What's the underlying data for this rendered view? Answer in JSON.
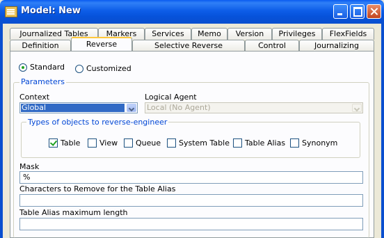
{
  "window": {
    "title": "Model: New"
  },
  "tabs_row1": [
    "Journalized Tables",
    "Markers",
    "Services",
    "Memo",
    "Version",
    "Privileges",
    "FlexFields"
  ],
  "tabs_row2": [
    "Definition",
    "Reverse",
    "Selective Reverse",
    "Control",
    "Journalizing"
  ],
  "active_tab": "Reverse",
  "mode": {
    "standard_label": "Standard",
    "customized_label": "Customized",
    "selected": "Standard"
  },
  "parameters": {
    "legend": "Parameters",
    "context_label": "Context",
    "context_value": "Global",
    "logical_agent_label": "Logical Agent",
    "logical_agent_value": "Local (No Agent)",
    "types_legend": "Types of objects to reverse-engineer",
    "types": [
      {
        "label": "Table",
        "checked": true
      },
      {
        "label": "View",
        "checked": false
      },
      {
        "label": "Queue",
        "checked": false
      },
      {
        "label": "System Table",
        "checked": false
      },
      {
        "label": "Table Alias",
        "checked": false
      },
      {
        "label": "Synonym",
        "checked": false
      }
    ],
    "mask_label": "Mask",
    "mask_value": "%",
    "chars_remove_label": "Characters to Remove for the Table Alias",
    "chars_remove_value": "",
    "alias_maxlen_label": "Table Alias maximum length",
    "alias_maxlen_value": ""
  }
}
